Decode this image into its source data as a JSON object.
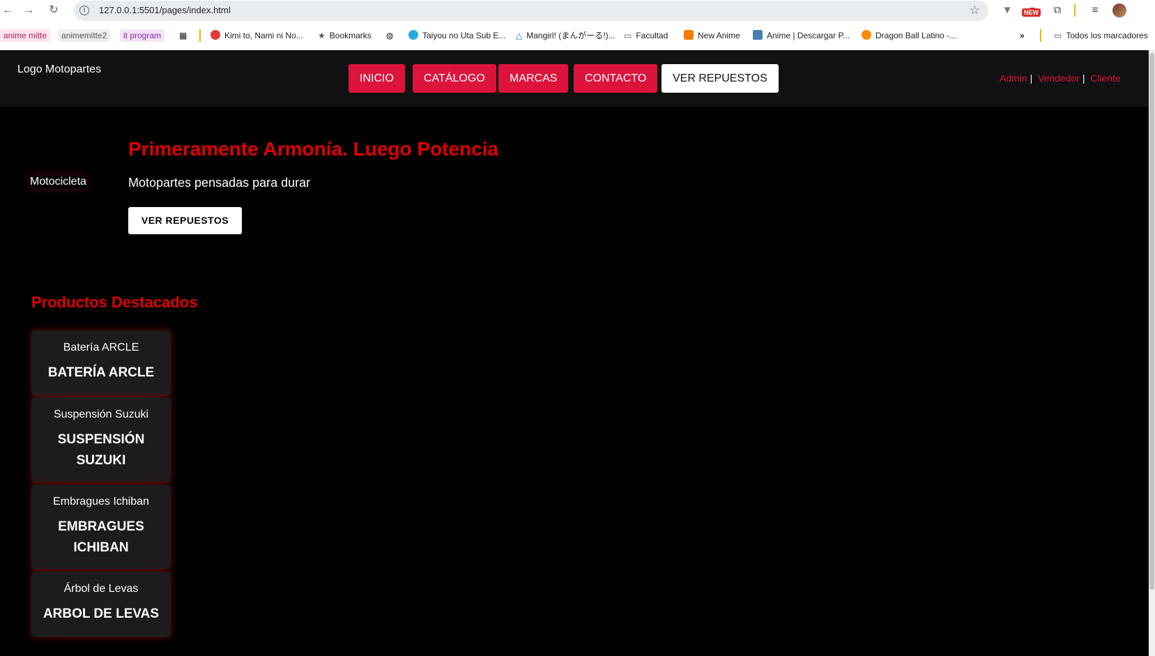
{
  "browser": {
    "url": "127.0.0.1:5501/pages/index.html",
    "new_badge": "NEW",
    "bookmarks": [
      {
        "label": "anime mitte"
      },
      {
        "label": "animemitte2"
      },
      {
        "label": "it program"
      },
      {
        "label": "Kimi to, Nami ni No..."
      },
      {
        "label": "Bookmarks"
      },
      {
        "label": "Taiyou no Uta Sub E..."
      },
      {
        "label": "Mangirl! (まんがーる!)..."
      },
      {
        "label": "Facultad"
      },
      {
        "label": "New Anime"
      },
      {
        "label": "Anime | Descargar P..."
      },
      {
        "label": "Dragon Ball Latino -..."
      }
    ],
    "more_bookmarks": "»",
    "all_bookmarks": "Todos los marcadores"
  },
  "header": {
    "logo_alt": "Logo Motopartes",
    "nav": [
      "INICIO",
      "CATÁLOGO",
      "MARCAS",
      "CONTACTO"
    ],
    "nav_cta": "VER REPUESTOS",
    "roles": [
      "Admin",
      "Vendedor",
      "Cliente"
    ],
    "role_sep": "|"
  },
  "hero": {
    "image_alt": "Motocicleta",
    "title": "Primeramente Armonía. Luego Potencia",
    "subtitle": "Motopartes pensadas para durar",
    "button": "VER REPUESTOS"
  },
  "featured": {
    "title": "Productos Destacados",
    "products": [
      {
        "image_alt": "Batería ARCLE",
        "name": "Batería ARCLE"
      },
      {
        "image_alt": "Suspensión Suzuki",
        "name": "Suspensión Suzuki"
      },
      {
        "image_alt": "Embragues Ichiban",
        "name": "Embragues Ichiban"
      },
      {
        "image_alt": "Árbol de Levas",
        "name": "Arbol de Levas"
      }
    ]
  },
  "colors": {
    "accent": "#dc143c",
    "title_red": "#e00000",
    "header_bg": "#111111",
    "page_bg": "#000000"
  }
}
